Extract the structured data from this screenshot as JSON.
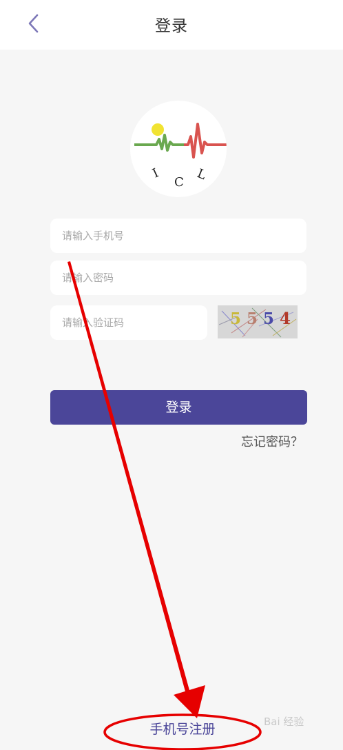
{
  "header": {
    "back_icon": "chevron-left-icon",
    "title": "登录"
  },
  "logo": {
    "letters": [
      "I",
      "C",
      "L"
    ],
    "colors": {
      "sun": "#f1e332",
      "wave_green": "#6aa84f",
      "wave_red": "#d9534f"
    }
  },
  "form": {
    "phone_placeholder": "请输入手机号",
    "password_placeholder": "请输入密码",
    "code_placeholder": "请输入验证码",
    "captcha_text": "5554",
    "captcha_digits": [
      {
        "char": "5",
        "color": "#c9b83a"
      },
      {
        "char": "5",
        "color": "#b87f6f"
      },
      {
        "char": "5",
        "color": "#4a4aa8"
      },
      {
        "char": "4",
        "color": "#b23a2a"
      }
    ]
  },
  "actions": {
    "login_label": "登录",
    "forgot_label": "忘记密码？",
    "register_label": "手机号注册"
  },
  "theme": {
    "accent": "#4b4699",
    "background": "#f6f6f6",
    "annotation_red": "#e60000"
  },
  "watermark": "Bai 经验"
}
